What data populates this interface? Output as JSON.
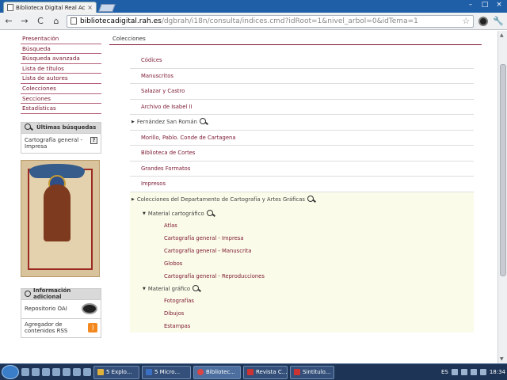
{
  "browser": {
    "tab_title": "Biblioteca Digital Real Aca",
    "tab_close": "×",
    "url_host": "bibliotecadigital.rah.es",
    "url_path": "/dgbrah/i18n/consulta/indices.cmd?idRoot=1&nivel_arbol=0&idTema=1",
    "back": "←",
    "forward": "→",
    "reload": "C",
    "home": "⌂",
    "star": "☆",
    "wrench": "🔧",
    "minimize": "–",
    "maximize": "□",
    "close": "×"
  },
  "sidebar": {
    "menu": [
      "Presentación",
      "Búsqueda",
      "Búsqueda avanzada",
      "Lista de títulos",
      "Lista de autores",
      "Colecciones",
      "Secciones",
      "Estadísticas"
    ],
    "recent_title": "Últimas búsquedas",
    "recent_item": "Cartografía general - Impresa",
    "help_glyph": "?",
    "info_title": "Información adicional",
    "oai_label": "Repositorio OAI",
    "rss_label": "Agregador de contenidos RSS",
    "rss_glyph": ")"
  },
  "main": {
    "heading": "Colecciones",
    "collections_top": [
      "Códices",
      "Manuscritos",
      "Salazar y Castro",
      "Archivo de Isabel II"
    ],
    "fernandez": "Fernández San Román",
    "collections_mid": [
      "Morillo, Pablo. Conde de Cartagena",
      "Biblioteca de Cortes",
      "Grandes Formatos",
      "Impresos"
    ],
    "dept": "Colecciones del Departamento de Cartografía y Artes Gráficas",
    "material_carto": "Material cartográfico",
    "carto_items": [
      "Atlas",
      "Cartografía general - Impresa",
      "Cartografía general - Manuscrita",
      "Globos",
      "Cartografía general - Reproducciones"
    ],
    "material_grafico": "Material gráfico",
    "grafico_items": [
      "Fotografías",
      "Dibujos",
      "Estampas"
    ],
    "tri_right": "▶",
    "tri_down": "▼"
  },
  "taskbar": {
    "items": [
      "5 Explo...",
      "5 Micro...",
      "Bibliotec...",
      "Revista C...",
      "Sintitulo..."
    ],
    "lang": "ES",
    "clock": "18:34"
  },
  "scroll": {
    "up": "▲",
    "down": "▼"
  }
}
